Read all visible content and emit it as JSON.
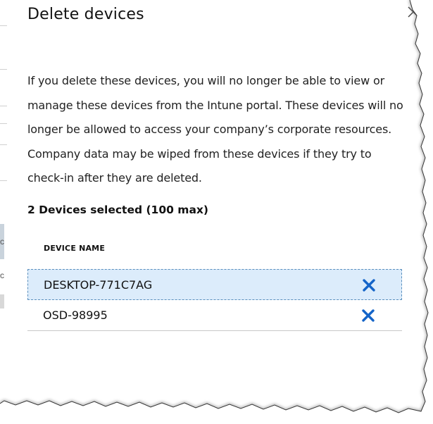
{
  "dialog": {
    "title": "Delete devices",
    "close_icon": "close-icon",
    "description": "If you delete these devices, you will no longer be able to view or manage these devices from the Intune portal. These devices will no longer be allowed to access your company’s corporate resources. Company data may be wiped from these devices if they try to check-in after they are deleted.",
    "selected_count_label": "2 Devices selected (100 max)",
    "table": {
      "column_header": "DEVICE NAME",
      "rows": [
        {
          "name": "DESKTOP-771C7AG",
          "selected": true,
          "remove_icon": "remove-x-icon"
        },
        {
          "name": "OSD-98995",
          "selected": false,
          "remove_icon": "remove-x-icon"
        }
      ]
    }
  },
  "background": {
    "fragment_letters": [
      "c",
      "c"
    ]
  },
  "colors": {
    "selected_row_bg": "#dcecfb",
    "selected_row_border": "#5a8fbd",
    "remove_icon": "#1464c8",
    "text": "#111111"
  }
}
